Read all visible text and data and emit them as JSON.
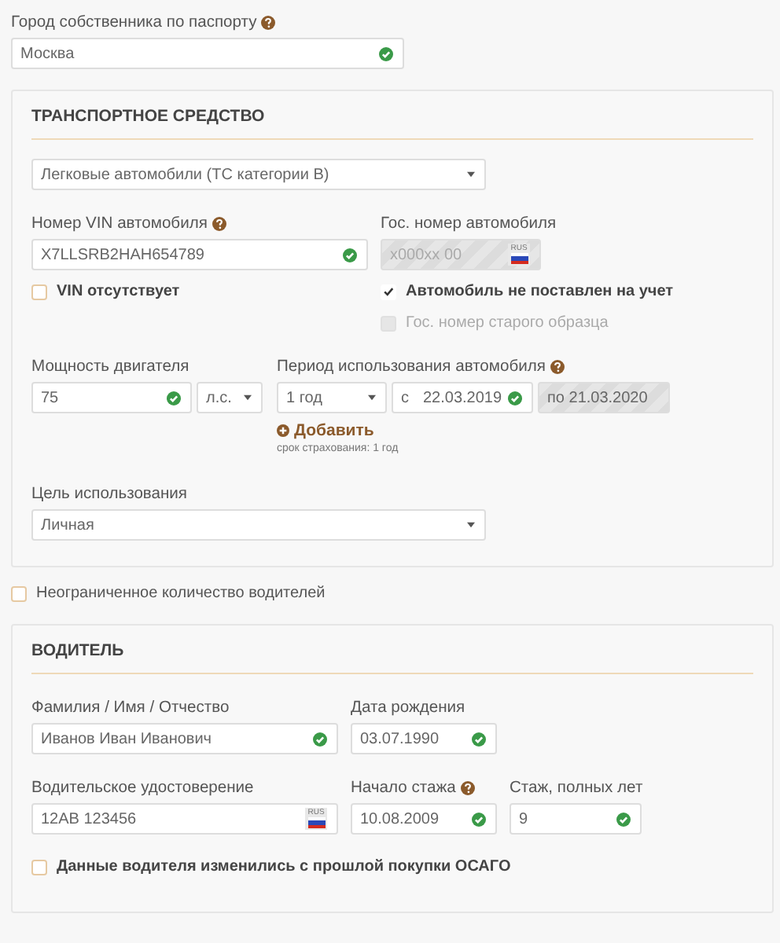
{
  "owner_city": {
    "label": "Город собственника по паспорту",
    "help": true,
    "value": "Москва",
    "valid": true
  },
  "vehicle": {
    "title": "ТРАНСПОРТНОЕ СРЕДСТВО",
    "category": {
      "value": "Легковые автомобили (ТС категории B)"
    },
    "vin": {
      "label": "Номер VIN автомобиля",
      "help": true,
      "value": "X7LLSRB2HAH654789",
      "valid": true
    },
    "plate": {
      "label": "Гос. номер автомобиля",
      "placeholder": "x000xx 00",
      "disabled": true,
      "flag": "RUS"
    },
    "vin_missing": {
      "label": "VIN отсутствует",
      "checked": false,
      "disabled": false
    },
    "plate_options": [
      {
        "label": "Автомобиль не поставлен на учет",
        "checked": true,
        "disabled": false
      },
      {
        "label": "Гос. номер старого образца",
        "checked": false,
        "disabled": true
      }
    ],
    "power": {
      "label": "Мощность двигателя",
      "value": "75",
      "valid": true,
      "unit": "л.с."
    },
    "period": {
      "label": "Период использования автомобиля",
      "help": true,
      "duration": "1 год",
      "from_prefix": "с",
      "from": "22.03.2019",
      "from_valid": true,
      "to": "по 21.03.2020",
      "add_link": "Добавить",
      "note": "срок страхования: 1 год"
    },
    "purpose": {
      "label": "Цель использования",
      "value": "Личная"
    }
  },
  "unlimited_drivers": {
    "label": "Неограниченное количество водителей",
    "checked": false,
    "disabled": false
  },
  "driver": {
    "title": "ВОДИТЕЛЬ",
    "name": {
      "label": "Фамилия / Имя / Отчество",
      "value": "Иванов Иван Иванович",
      "valid": true
    },
    "birth_date": {
      "label": "Дата рождения",
      "value": "03.07.1990",
      "valid": true
    },
    "license": {
      "label": "Водительское удостоверение",
      "value": "12AB 123456",
      "valid": false,
      "flag": "RUS"
    },
    "experience_start": {
      "label": "Начало стажа",
      "help": true,
      "value": "10.08.2009",
      "valid": true
    },
    "experience_years": {
      "label": "Стаж, полных лет",
      "value": "9",
      "valid": true
    },
    "changed": {
      "label": "Данные водителя изменились с прошлой покупки ОСАГО",
      "checked": false,
      "disabled": false
    }
  }
}
